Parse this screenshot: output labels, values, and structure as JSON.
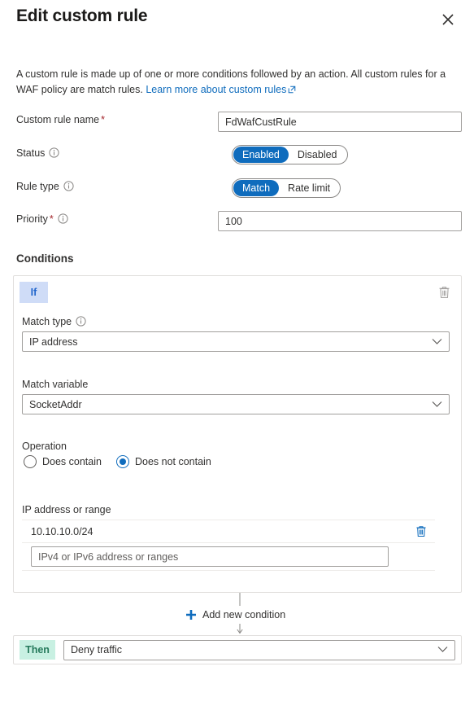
{
  "header": {
    "title": "Edit custom rule",
    "close_label": "Close"
  },
  "intro": {
    "text_before": "A custom rule is made up of one or more conditions followed by an action. All custom rules for a WAF policy are match rules. ",
    "link_text": "Learn more about custom rules",
    "link_icon": "external-link-icon"
  },
  "form": {
    "rule_name": {
      "label": "Custom rule name",
      "required_marker": "*",
      "value": "FdWafCustRule",
      "placeholder": ""
    },
    "status": {
      "label": "Status",
      "info_icon": "info-icon",
      "options": [
        "Enabled",
        "Disabled"
      ],
      "selected": "Enabled"
    },
    "rule_type": {
      "label": "Rule type",
      "info_icon": "info-icon",
      "options": [
        "Match",
        "Rate limit"
      ],
      "selected": "Match"
    },
    "priority": {
      "label": "Priority",
      "required_marker": "*",
      "info_icon": "info-icon",
      "value": "100",
      "placeholder": ""
    }
  },
  "conditions": {
    "section_title": "Conditions",
    "if_badge": "If",
    "delete_condition_icon": "trash-icon",
    "match_type": {
      "label": "Match type",
      "info_icon": "info-icon",
      "value": "IP address",
      "chevron": "chevron-down-icon"
    },
    "match_variable": {
      "label": "Match variable",
      "value": "SocketAddr",
      "chevron": "chevron-down-icon"
    },
    "operation": {
      "label": "Operation",
      "options": [
        "Does contain",
        "Does not contain"
      ],
      "selected": "Does not contain"
    },
    "ip_addresses": {
      "label": "IP address or range",
      "entries": [
        "10.10.10.0/24"
      ],
      "delete_icon": "trash-icon",
      "input_value": "",
      "input_placeholder": "IPv4 or IPv6 address or ranges"
    }
  },
  "add_condition": {
    "label": "Add new condition",
    "icon": "plus-icon"
  },
  "then": {
    "badge": "Then",
    "value": "Deny traffic",
    "chevron": "chevron-down-icon"
  },
  "colors": {
    "accent_blue": "#0f6cbd",
    "link_blue": "#0f6cbd",
    "if_badge_bg": "#cfdcf7",
    "if_badge_fg": "#2266cc",
    "then_badge_bg": "#c8f0e2",
    "then_badge_fg": "#267a5c",
    "required_red": "#a4262c",
    "border_gray": "#a19f9d",
    "card_border": "#e1dfdd"
  }
}
